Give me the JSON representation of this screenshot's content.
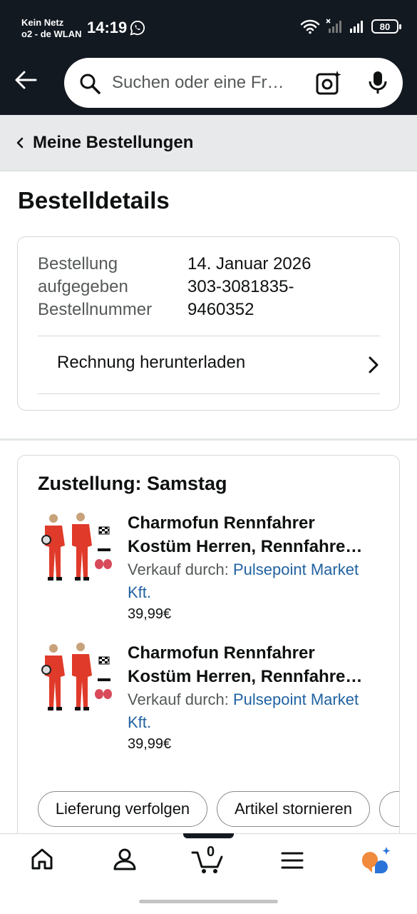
{
  "status_bar": {
    "carrier_line1": "Kein Netz",
    "carrier_line2": "o2 - de WLAN",
    "time": "14:19",
    "battery": "80"
  },
  "header": {
    "search_placeholder": "Suchen oder eine Fr…"
  },
  "breadcrumb": {
    "label": "Meine Bestellungen"
  },
  "page_title": "Bestelldetails",
  "order": {
    "labels": [
      "Bestellung",
      "aufgegeben",
      "Bestellnummer"
    ],
    "values": [
      "14. Januar 2026",
      "303-3081835-",
      "9460352"
    ],
    "invoice_label": "Rechnung herunterladen"
  },
  "delivery": {
    "title": "Zustellung: Samstag",
    "items": [
      {
        "name_line1": "Charmofun Rennfahrer",
        "name_line2": "Kostüm Herren, Rennfahre…",
        "sold_by_label": "Verkauf durch: ",
        "seller": "Pulsepoint Market",
        "seller_line2": "Kft.",
        "price": "39,99€"
      },
      {
        "name_line1": "Charmofun Rennfahrer",
        "name_line2": "Kostüm Herren, Rennfahre…",
        "sold_by_label": "Verkauf durch: ",
        "seller": "Pulsepoint Market",
        "seller_line2": "Kft.",
        "price": "39,99€"
      }
    ],
    "actions": [
      "Lieferung verfolgen",
      "Artikel stornieren"
    ]
  },
  "bottom_nav": {
    "items": [
      "home-icon",
      "account-icon",
      "cart-icon",
      "menu-icon",
      "rufus-icon"
    ],
    "cart_count": "0"
  },
  "colors": {
    "header_bg": "#131921",
    "link": "#2162a1",
    "breadcrumb_bg": "#e7e9ea"
  }
}
